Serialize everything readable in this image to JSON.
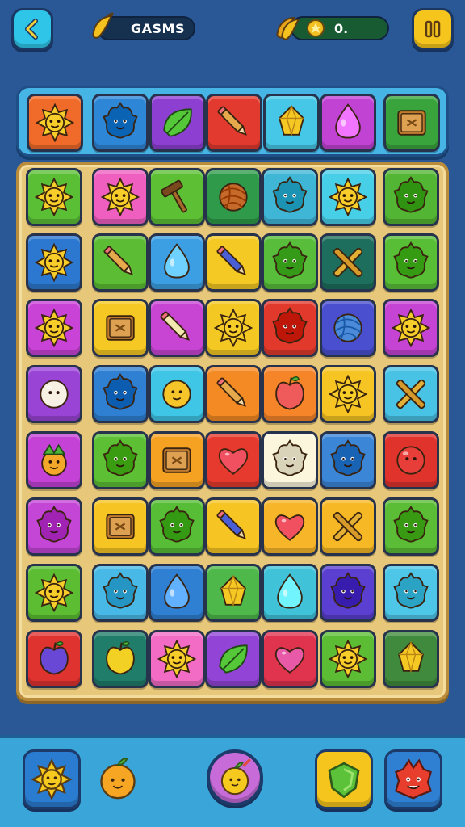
{
  "header": {
    "player_name": "GASMS",
    "coin_value": "0.",
    "back_icon": "chevron-left-icon",
    "pause_icon": "pause-icon",
    "name_badge_icon": "banana-icon",
    "coin_badge_icon": "banana-bunch-icon"
  },
  "top_row": [
    {
      "color": "#f06a2a",
      "icon": "sun"
    },
    {
      "color": "#2e86d6",
      "icon": "blob"
    },
    {
      "color": "#8d3fd1",
      "icon": "leaf"
    },
    {
      "color": "#e23a2e",
      "icon": "pencil"
    },
    {
      "color": "#46c7e8",
      "icon": "gem"
    },
    {
      "color": "#c043d4",
      "icon": "drop"
    },
    {
      "color": "#3aa43c",
      "icon": "box"
    }
  ],
  "board": [
    [
      {
        "color": "#5bbf36",
        "icon": "sun"
      },
      {
        "color": "#ee5fc0",
        "icon": "sun"
      },
      {
        "color": "#5cbf34",
        "icon": "hammer"
      },
      {
        "color": "#2f9a49",
        "icon": "yarn"
      },
      {
        "color": "#3fb6d6",
        "icon": "blob"
      },
      {
        "color": "#48cfe8",
        "icon": "sun"
      },
      {
        "color": "#53b534",
        "icon": "blob"
      }
    ],
    [
      {
        "color": "#2c78d0",
        "icon": "sun"
      },
      {
        "color": "#5cbd35",
        "icon": "pencil"
      },
      {
        "color": "#3d9fe3",
        "icon": "drop"
      },
      {
        "color": "#f4c923",
        "icon": "pencil"
      },
      {
        "color": "#57bd3a",
        "icon": "blob"
      },
      {
        "color": "#1d6e5c",
        "icon": "cross"
      },
      {
        "color": "#58be36",
        "icon": "blob"
      }
    ],
    [
      {
        "color": "#c843d6",
        "icon": "sun"
      },
      {
        "color": "#f6c823",
        "icon": "box"
      },
      {
        "color": "#c845d4",
        "icon": "pencil"
      },
      {
        "color": "#f4c823",
        "icon": "sun"
      },
      {
        "color": "#e13a2c",
        "icon": "blob"
      },
      {
        "color": "#4a4fd0",
        "icon": "yarn"
      },
      {
        "color": "#c644d4",
        "icon": "sun"
      }
    ],
    [
      {
        "color": "#9a44d6",
        "icon": "ball"
      },
      {
        "color": "#2f7fd2",
        "icon": "blob"
      },
      {
        "color": "#3fc5e6",
        "icon": "face"
      },
      {
        "color": "#f48a23",
        "icon": "pencil"
      },
      {
        "color": "#f6852a",
        "icon": "apple"
      },
      {
        "color": "#f6c524",
        "icon": "sun"
      },
      {
        "color": "#48c3e6",
        "icon": "cross"
      }
    ],
    [
      {
        "color": "#c443d6",
        "icon": "berry"
      },
      {
        "color": "#5cbf34",
        "icon": "blob"
      },
      {
        "color": "#f5a223",
        "icon": "box"
      },
      {
        "color": "#e63a2e",
        "icon": "heart"
      },
      {
        "color": "#fbf6dc",
        "icon": "blob"
      },
      {
        "color": "#3c86d8",
        "icon": "blob"
      },
      {
        "color": "#e0332c",
        "icon": "ball"
      }
    ],
    [
      {
        "color": "#c446d6",
        "icon": "blob"
      },
      {
        "color": "#f6c524",
        "icon": "box"
      },
      {
        "color": "#57bc36",
        "icon": "blob"
      },
      {
        "color": "#f6c524",
        "icon": "pencil"
      },
      {
        "color": "#f7b62a",
        "icon": "heart"
      },
      {
        "color": "#f6b824",
        "icon": "cross"
      },
      {
        "color": "#5bbd36",
        "icon": "blob"
      }
    ],
    [
      {
        "color": "#5cbd33",
        "icon": "sun"
      },
      {
        "color": "#48b9e6",
        "icon": "blob"
      },
      {
        "color": "#2f7fd2",
        "icon": "drop"
      },
      {
        "color": "#4fb84a",
        "icon": "gem"
      },
      {
        "color": "#40c2d9",
        "icon": "drop"
      },
      {
        "color": "#5a3fd0",
        "icon": "blob"
      },
      {
        "color": "#4dc6e8",
        "icon": "blob"
      }
    ],
    [
      {
        "color": "#df3330",
        "icon": "apple"
      },
      {
        "color": "#1f7d6a",
        "icon": "apple"
      },
      {
        "color": "#f26cc6",
        "icon": "sun"
      },
      {
        "color": "#9144d6",
        "icon": "leaf"
      },
      {
        "color": "#e0334e",
        "icon": "heart"
      },
      {
        "color": "#5cbd34",
        "icon": "sun"
      },
      {
        "color": "#3f8a3c",
        "icon": "gem"
      }
    ]
  ],
  "bottom": {
    "left_button_icon": "sun-icon",
    "token_icon": "fruit-icon",
    "center_button_icon": "fruit-icon",
    "shield_button_icon": "shield-icon",
    "right_button_icon": "blob-icon"
  }
}
